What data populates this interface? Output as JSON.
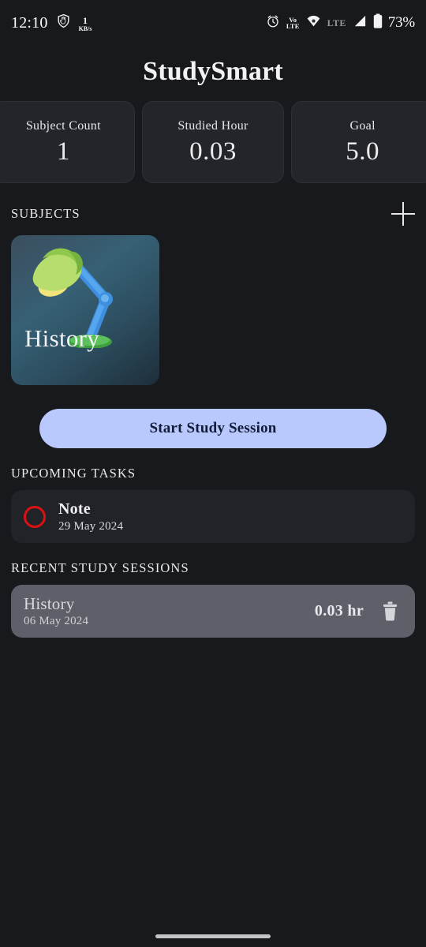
{
  "status_bar": {
    "time": "12:10",
    "privacy_icon": "shield-hand-icon",
    "network_speed_value": "1",
    "network_speed_unit": "KB/s",
    "alarm_icon": "alarm-clock-icon",
    "volte_line1": "Vo",
    "volte_line2": "LTE",
    "wifi_icon": "wifi-icon",
    "lte_label": "LTE",
    "signal_icon": "signal-bars-icon",
    "battery_icon": "battery-icon",
    "battery_percent": "73%"
  },
  "header": {
    "title": "StudySmart"
  },
  "stats": [
    {
      "label": "Subject Count",
      "value": "1"
    },
    {
      "label": "Studied Hour",
      "value": "0.03"
    },
    {
      "label": "Goal",
      "value": "5.0"
    }
  ],
  "subjects_section": {
    "title": "SUBJECTS",
    "add_icon": "plus-icon",
    "items": [
      {
        "name": "History",
        "illustration": "desk-lamp-icon"
      }
    ]
  },
  "start_button": {
    "label": "Start Study Session"
  },
  "tasks_section": {
    "title": "UPCOMING TASKS",
    "items": [
      {
        "checkbox_icon": "circle-checkbox-icon",
        "title": "Note",
        "date": "29 May 2024"
      }
    ]
  },
  "sessions_section": {
    "title": "RECENT STUDY SESSIONS",
    "items": [
      {
        "subject": "History",
        "date": "06 May 2024",
        "duration": "0.03 hr",
        "delete_icon": "trash-icon"
      }
    ]
  },
  "nav": {
    "gesture_bar": "home-gesture-bar"
  },
  "colors": {
    "page_background": "#18191d",
    "card_background": "#23252b",
    "accent_button": "#bac9fd",
    "accent_button_text": "#111b38",
    "task_checkbox": "#dd1111",
    "session_card_background": "#5d6068",
    "subject_card_gradient_start": "#3b4e5f",
    "subject_card_gradient_end": "#1e2e3a"
  }
}
